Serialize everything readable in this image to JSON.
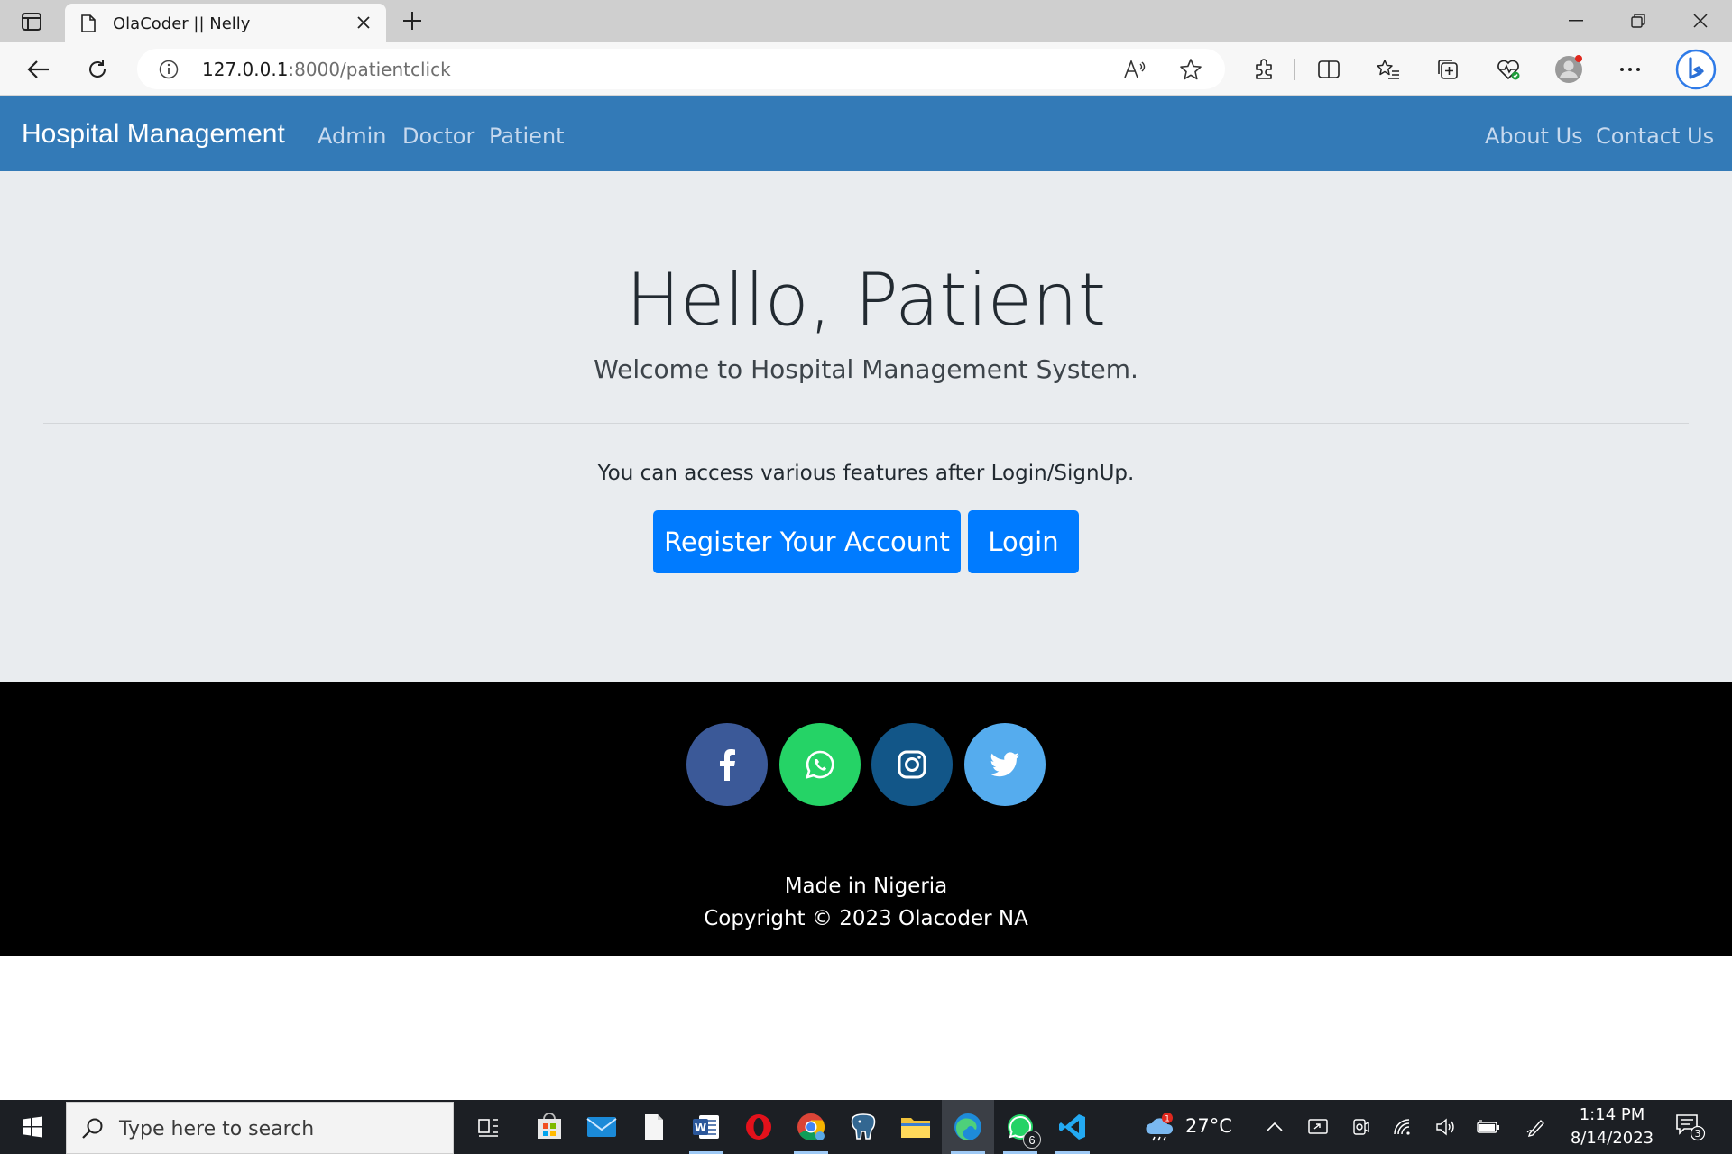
{
  "browser": {
    "tab_title": "OlaCoder || Nelly",
    "url_host": "127.0.0.1",
    "url_rest": ":8000/patientclick"
  },
  "navbar": {
    "brand": "Hospital Management",
    "links_left": [
      "Admin",
      "Doctor",
      "Patient"
    ],
    "links_right": [
      "About Us",
      "Contact Us"
    ]
  },
  "jumbotron": {
    "title": "Hello, Patient",
    "lead": "Welcome to Hospital Management System.",
    "text": "You can access various features after Login/SignUp.",
    "register_label": "Register Your Account",
    "login_label": "Login"
  },
  "footer": {
    "social": [
      {
        "name": "facebook-icon",
        "color": "#3b5998"
      },
      {
        "name": "whatsapp-icon",
        "color": "#25d366"
      },
      {
        "name": "instagram-icon",
        "color": "#125688"
      },
      {
        "name": "twitter-icon",
        "color": "#55acee"
      }
    ],
    "made_in": "Made in Nigeria",
    "copyright": "Copyright © 2023 Olacoder NA"
  },
  "taskbar": {
    "search_placeholder": "Type here to search",
    "weather_badge": "1",
    "temperature": "27°C",
    "time": "1:14 PM",
    "date": "8/14/2023",
    "whatsapp_badge": "6",
    "notification_count": "3"
  },
  "colors": {
    "navbar": "#337ab7",
    "jumbotron": "#e9ecef",
    "button": "#007bff",
    "footer": "#000000"
  }
}
